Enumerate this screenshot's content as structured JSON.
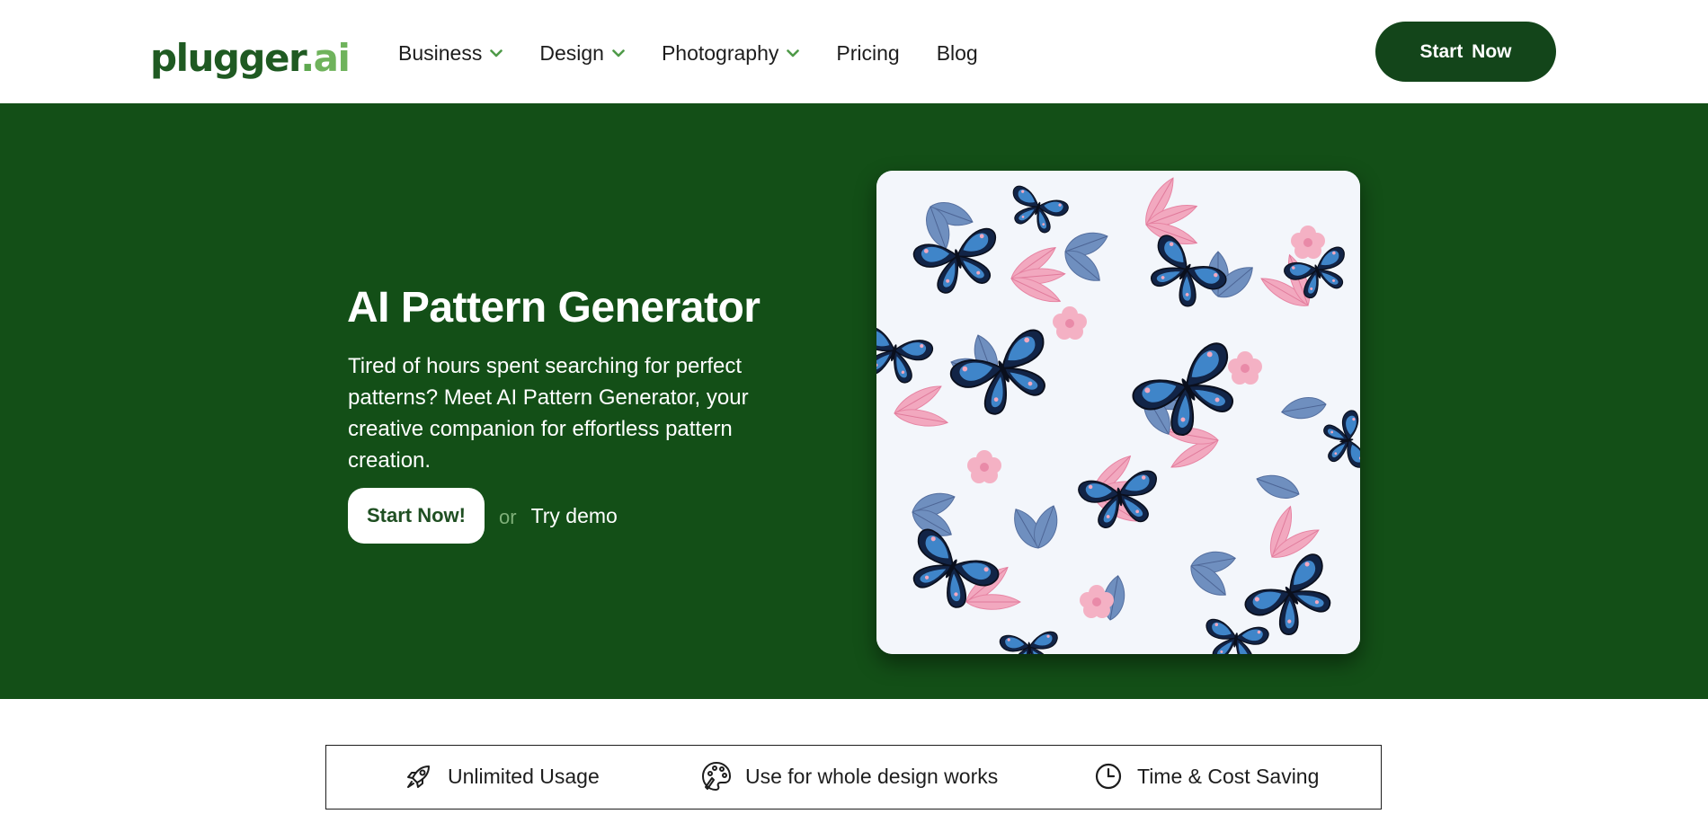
{
  "brand": {
    "logo_main": "plugger",
    "logo_dot": ".",
    "logo_ai": "ai",
    "primary_color": "#134f17",
    "dark_green": "#13451a",
    "accent_green": "#6fb35c"
  },
  "nav": {
    "items": [
      {
        "label": "Business",
        "has_dropdown": true,
        "icon": "chevron-down-icon"
      },
      {
        "label": "Design",
        "has_dropdown": true,
        "icon": "chevron-down-icon"
      },
      {
        "label": "Photography",
        "has_dropdown": true,
        "icon": "chevron-down-icon"
      },
      {
        "label": "Pricing",
        "has_dropdown": false
      },
      {
        "label": "Blog",
        "has_dropdown": false
      }
    ],
    "cta_label": "Start  Now"
  },
  "hero": {
    "title": "AI Pattern Generator",
    "description": "Tired of hours spent searching for perfect patterns? Meet AI Pattern Generator, your creative companion for effortless pattern creation.",
    "cta_primary": "Start Now!",
    "cta_separator": "or",
    "cta_secondary": "Try demo",
    "image": "butterfly-floral-pattern"
  },
  "features": [
    {
      "label": "Unlimited Usage",
      "icon": "rocket-icon"
    },
    {
      "label": "Use for whole design works",
      "icon": "palette-icon"
    },
    {
      "label": "Time & Cost Saving",
      "icon": "clock-icon"
    }
  ]
}
